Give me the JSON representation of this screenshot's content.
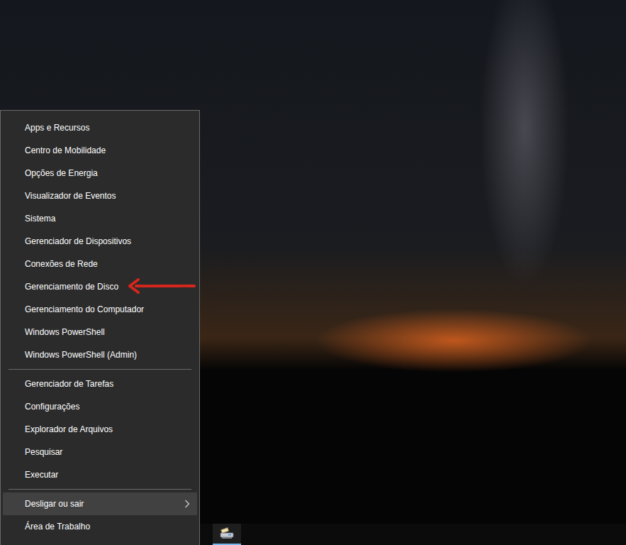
{
  "menu": {
    "sections": [
      {
        "items": [
          {
            "label": "Apps e Recursos",
            "highlighted": false,
            "submenu": false,
            "marked": false
          },
          {
            "label": "Centro de Mobilidade",
            "highlighted": false,
            "submenu": false,
            "marked": false
          },
          {
            "label": "Opções de Energia",
            "highlighted": false,
            "submenu": false,
            "marked": false
          },
          {
            "label": "Visualizador de Eventos",
            "highlighted": false,
            "submenu": false,
            "marked": false
          },
          {
            "label": "Sistema",
            "highlighted": false,
            "submenu": false,
            "marked": false
          },
          {
            "label": "Gerenciador de Dispositivos",
            "highlighted": false,
            "submenu": false,
            "marked": false
          },
          {
            "label": "Conexões de Rede",
            "highlighted": false,
            "submenu": false,
            "marked": false
          },
          {
            "label": "Gerenciamento de Disco",
            "highlighted": false,
            "submenu": false,
            "marked": true
          },
          {
            "label": "Gerenciamento do Computador",
            "highlighted": false,
            "submenu": false,
            "marked": false
          },
          {
            "label": "Windows PowerShell",
            "highlighted": false,
            "submenu": false,
            "marked": false
          },
          {
            "label": "Windows PowerShell (Admin)",
            "highlighted": false,
            "submenu": false,
            "marked": false
          }
        ]
      },
      {
        "items": [
          {
            "label": "Gerenciador de Tarefas",
            "highlighted": false,
            "submenu": false,
            "marked": false
          },
          {
            "label": "Configurações",
            "highlighted": false,
            "submenu": false,
            "marked": false
          },
          {
            "label": "Explorador de Arquivos",
            "highlighted": false,
            "submenu": false,
            "marked": false
          },
          {
            "label": "Pesquisar",
            "highlighted": false,
            "submenu": false,
            "marked": false
          },
          {
            "label": "Executar",
            "highlighted": false,
            "submenu": false,
            "marked": false
          }
        ]
      },
      {
        "items": [
          {
            "label": "Desligar ou sair",
            "highlighted": true,
            "submenu": true,
            "marked": false
          },
          {
            "label": "Área de Trabalho",
            "highlighted": false,
            "submenu": false,
            "marked": false
          }
        ]
      }
    ]
  },
  "taskbar": {
    "apps": [
      {
        "running": true
      }
    ]
  }
}
